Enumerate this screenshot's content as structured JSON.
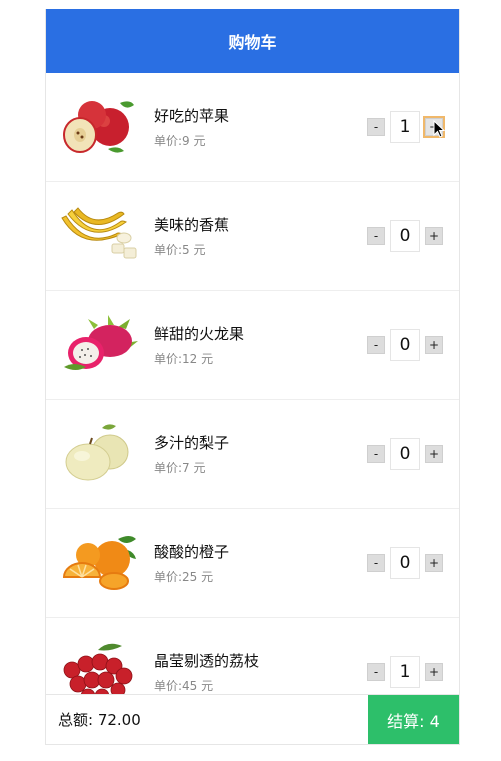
{
  "header": {
    "title": "购物车"
  },
  "items": [
    {
      "name": "好吃的苹果",
      "price": "单价:9 元",
      "qty": "1",
      "minus": "-",
      "plus": "+"
    },
    {
      "name": "美味的香蕉",
      "price": "单价:5 元",
      "qty": "0",
      "minus": "-",
      "plus": "+"
    },
    {
      "name": "鲜甜的火龙果",
      "price": "单价:12 元",
      "qty": "0",
      "minus": "-",
      "plus": "+"
    },
    {
      "name": "多汁的梨子",
      "price": "单价:7 元",
      "qty": "0",
      "minus": "-",
      "plus": "+"
    },
    {
      "name": "酸酸的橙子",
      "price": "单价:25 元",
      "qty": "0",
      "minus": "-",
      "plus": "+"
    },
    {
      "name": "晶莹剔透的荔枝",
      "price": "单价:45 元",
      "qty": "1",
      "minus": "-",
      "plus": "+"
    }
  ],
  "footer": {
    "total": "总额: 72.00",
    "checkout": "结算: 4"
  },
  "colors": {
    "header": "#2a6fe3",
    "checkout": "#2dbf6a",
    "focus_ring": "#f0b86a"
  },
  "icons": [
    "apple-image",
    "banana-image",
    "dragonfruit-image",
    "pear-image",
    "orange-image",
    "lychee-image",
    "mouse-pointer-icon"
  ]
}
